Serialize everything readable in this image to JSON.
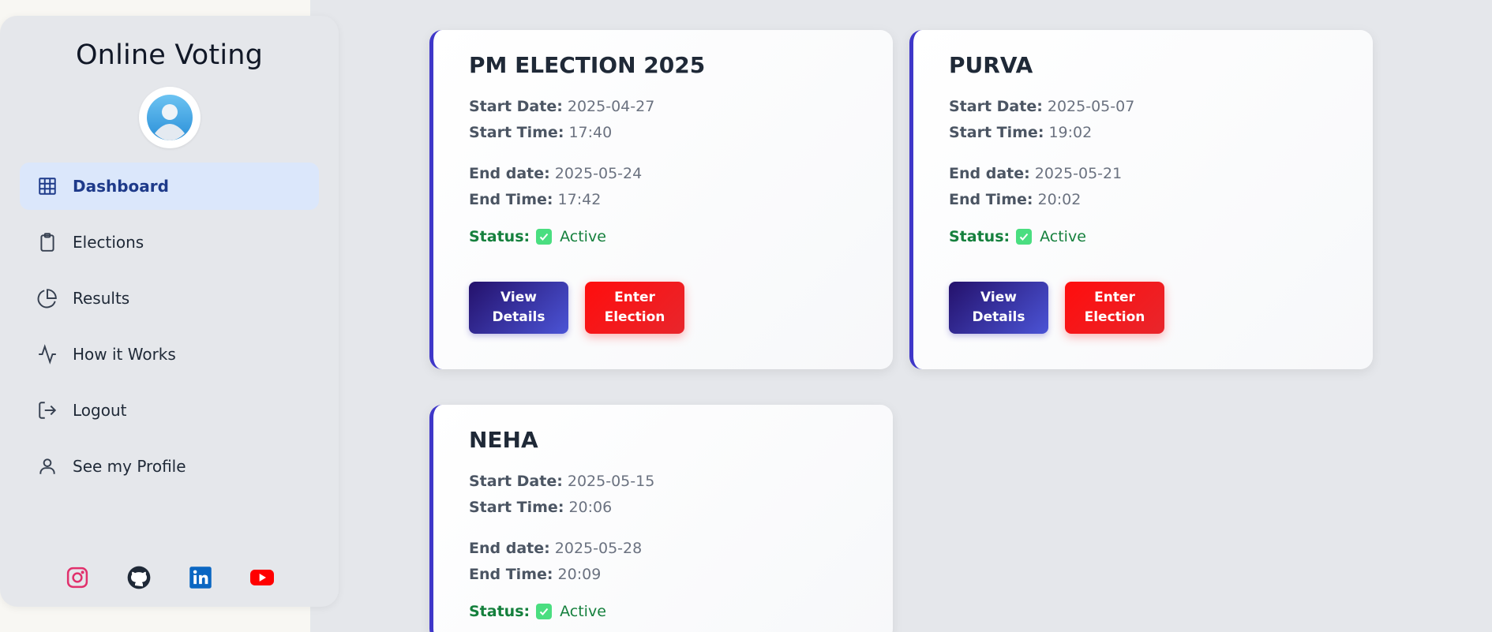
{
  "app": {
    "title": "Online Voting"
  },
  "sidebar": {
    "items": [
      {
        "label": "Dashboard",
        "icon": "grid-icon",
        "active": true
      },
      {
        "label": "Elections",
        "icon": "clipboard-icon"
      },
      {
        "label": "Results",
        "icon": "pie-chart-icon"
      },
      {
        "label": "How it Works",
        "icon": "activity-icon"
      },
      {
        "label": "Logout",
        "icon": "logout-icon"
      },
      {
        "label": "See my Profile",
        "icon": "user-icon"
      }
    ],
    "socials": [
      "instagram-icon",
      "github-icon",
      "linkedin-icon",
      "youtube-icon"
    ]
  },
  "labels": {
    "start_date": "Start Date:",
    "start_time": "Start Time:",
    "end_date": "End date:",
    "end_time": "End Time:",
    "status": "Status:",
    "view": "View Details",
    "enter": "Enter Election"
  },
  "elections": [
    {
      "title": "PM ELECTION 2025",
      "start_date": "2025-04-27",
      "start_time": "17:40",
      "end_date": "2025-05-24",
      "end_time": "17:42",
      "status": "Active"
    },
    {
      "title": "PURVA",
      "start_date": "2025-05-07",
      "start_time": "19:02",
      "end_date": "2025-05-21",
      "end_time": "20:02",
      "status": "Active"
    },
    {
      "title": "NEHA",
      "start_date": "2025-05-15",
      "start_time": "20:06",
      "end_date": "2025-05-28",
      "end_time": "20:09",
      "status": "Active"
    }
  ],
  "colors": {
    "accent": "#3f37c9",
    "view_button": "#3b2fa8",
    "enter_button": "#f01c1c",
    "active_status": "#15803d",
    "active_nav_bg": "#dbe7fb"
  }
}
